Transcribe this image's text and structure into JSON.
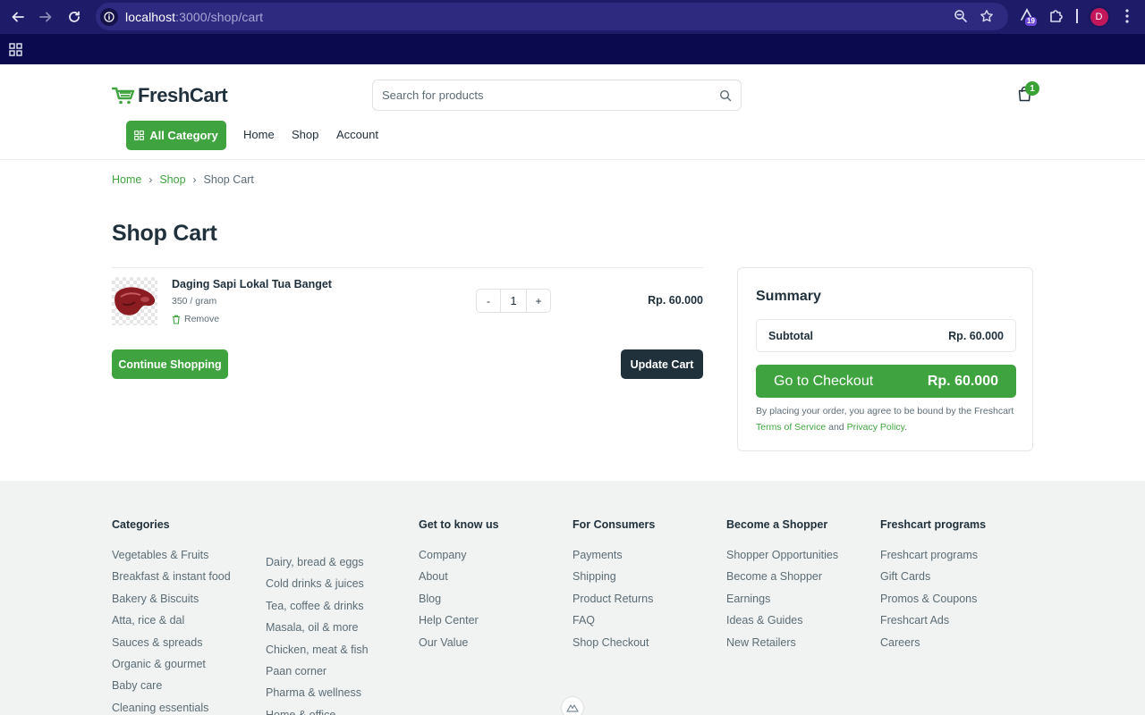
{
  "browser": {
    "url_host": "localhost",
    "url_path": ":3000/shop/cart",
    "extension_badge": "19",
    "profile_initial": "D"
  },
  "header": {
    "logo": "FreshCart",
    "search_placeholder": "Search for products",
    "cart_count": "1",
    "all_category": "All Category",
    "nav": [
      "Home",
      "Shop",
      "Account"
    ]
  },
  "breadcrumb": [
    "Home",
    "Shop",
    "Shop Cart"
  ],
  "page_title": "Shop Cart",
  "cart": {
    "item": {
      "name": "Daging Sapi Lokal Tua Banget",
      "unit": "350 / gram",
      "remove": "Remove",
      "qty": "1",
      "minus": "-",
      "plus": "+",
      "price": "Rp. 60.000"
    },
    "continue": "Continue Shopping",
    "update": "Update Cart"
  },
  "summary": {
    "title": "Summary",
    "subtotal_label": "Subtotal",
    "subtotal_value": "Rp. 60.000",
    "checkout_label": "Go to Checkout",
    "checkout_amount": "Rp. 60.000",
    "terms_text": "By placing your order, you agree to be bound by the Freshcart",
    "terms_link": "Terms of Service",
    "and": "and",
    "privacy_link": "Privacy Policy",
    "period": "."
  },
  "footer": {
    "categories": {
      "title": "Categories",
      "col1": [
        "Vegetables & Fruits",
        "Breakfast & instant food",
        "Bakery & Biscuits",
        "Atta, rice & dal",
        "Sauces & spreads",
        "Organic & gourmet",
        "Baby care",
        "Cleaning essentials"
      ],
      "col2": [
        "Dairy, bread & eggs",
        "Cold drinks & juices",
        "Tea, coffee & drinks",
        "Masala, oil & more",
        "Chicken, meat & fish",
        "Paan corner",
        "Pharma & wellness",
        "Home & office"
      ]
    },
    "know_us": {
      "title": "Get to know us",
      "items": [
        "Company",
        "About",
        "Blog",
        "Help Center",
        "Our Value"
      ]
    },
    "consumers": {
      "title": "For Consumers",
      "items": [
        "Payments",
        "Shipping",
        "Product Returns",
        "FAQ",
        "Shop Checkout"
      ]
    },
    "shopper": {
      "title": "Become a Shopper",
      "items": [
        "Shopper Opportunities",
        "Become a Shopper",
        "Earnings",
        "Ideas & Guides",
        "New Retailers"
      ]
    },
    "programs": {
      "title": "Freshcart programs",
      "items": [
        "Freshcart programs",
        "Gift Cards",
        "Promos & Coupons",
        "Freshcart Ads",
        "Careers"
      ]
    }
  },
  "colors": {
    "brand_green": "#3fa43f",
    "dark": "#21313c",
    "muted": "#5c6c75",
    "footer_bg": "#f0f3f2",
    "chrome": "#1e1b69"
  }
}
